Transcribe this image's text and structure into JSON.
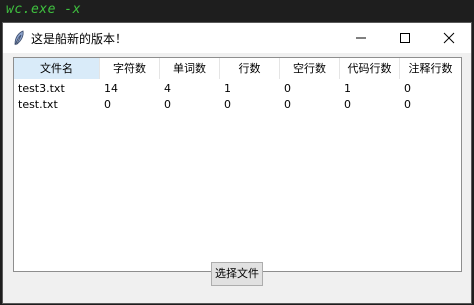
{
  "terminal": {
    "command": "wc.exe -x"
  },
  "window": {
    "title": "这是船新的版本！",
    "controls": {
      "minimize": "—",
      "maximize": "☐",
      "close": "✕"
    }
  },
  "table": {
    "columns": [
      "文件名",
      "字符数",
      "单词数",
      "行数",
      "空行数",
      "代码行数",
      "注释行数"
    ],
    "rows": [
      [
        "test3.txt",
        "14",
        "4",
        "1",
        "0",
        "1",
        "0"
      ],
      [
        "test.txt",
        "0",
        "0",
        "0",
        "0",
        "0",
        "0"
      ]
    ]
  },
  "button": {
    "label": "选择文件"
  }
}
